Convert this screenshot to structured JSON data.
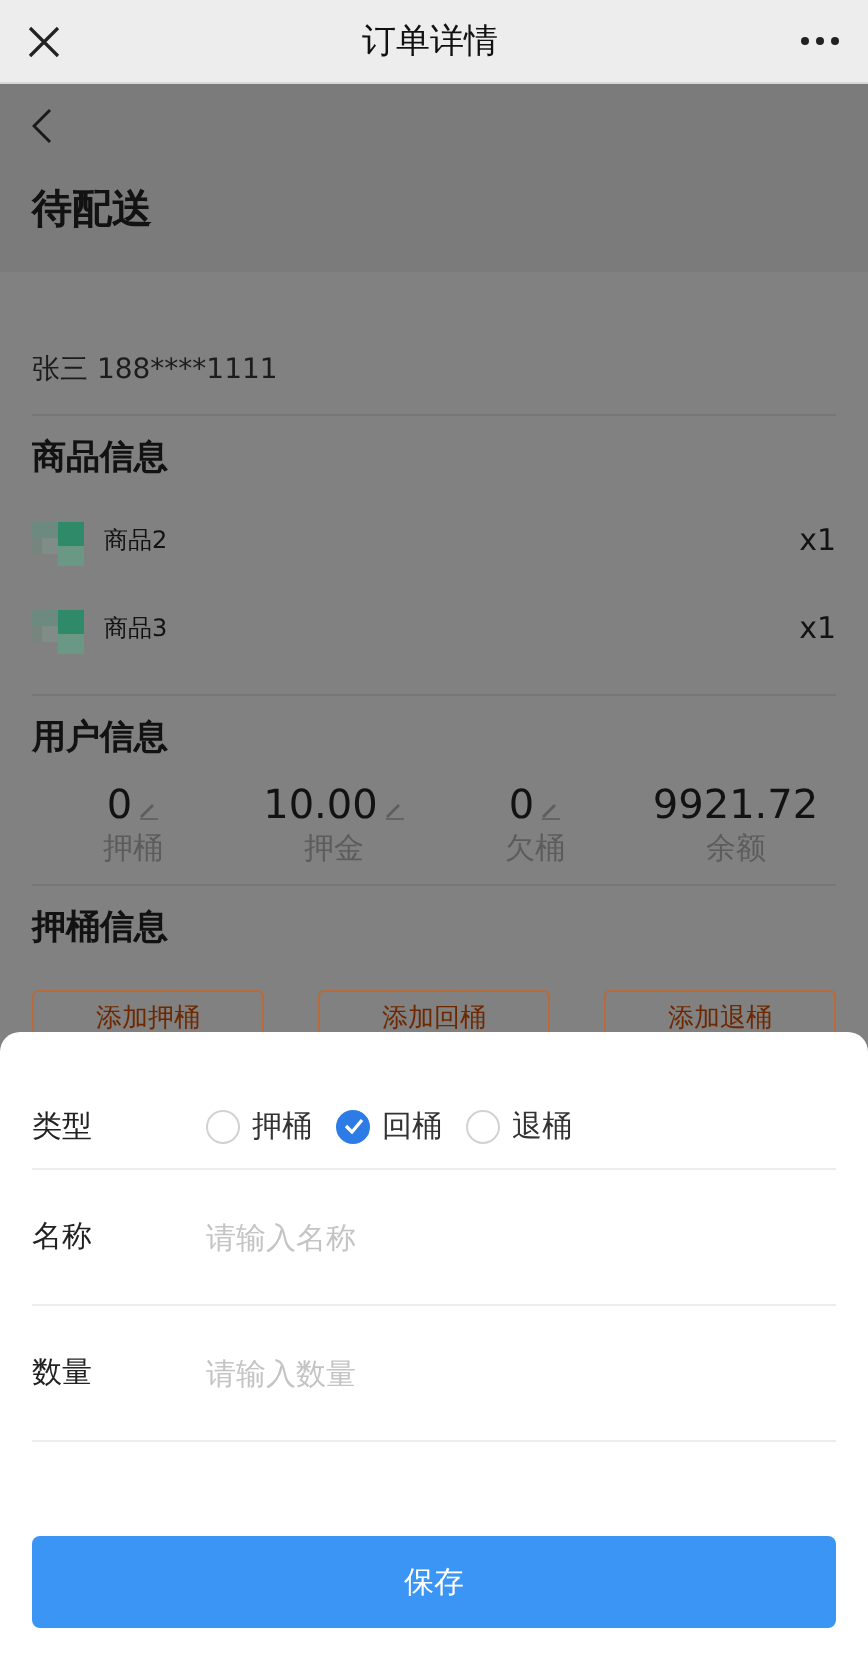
{
  "nav_bar": {
    "title": "订单详情"
  },
  "order": {
    "status": "待配送",
    "contact": "张三 188****1111",
    "products_title": "商品信息",
    "products": [
      {
        "kind": "picture",
        "name": "商品2",
        "quantity": "x1"
      },
      {
        "kind": "picture",
        "name": "商品3",
        "quantity": "x1"
      }
    ],
    "user_title": "用户信息",
    "stats": [
      {
        "value": "0",
        "label": "押桶",
        "editable": true
      },
      {
        "value": "10.00",
        "label": "押金",
        "editable": true
      },
      {
        "value": "0",
        "label": "欠桶",
        "editable": true
      },
      {
        "value": "9921.72",
        "label": "余额",
        "editable": false
      }
    ],
    "deposit_title": "押桶信息",
    "deposit_buttons": [
      "添加押桶",
      "添加回桶",
      "添加退桶"
    ]
  },
  "sheet": {
    "type_label": "类型",
    "types": [
      {
        "label": "押桶",
        "selected": false
      },
      {
        "label": "回桶",
        "selected": true
      },
      {
        "label": "退桶",
        "selected": false
      }
    ],
    "fields": [
      {
        "label": "名称",
        "placeholder": "请输入名称"
      },
      {
        "label": "数量",
        "placeholder": "请输入数量"
      }
    ],
    "save": "保存"
  }
}
